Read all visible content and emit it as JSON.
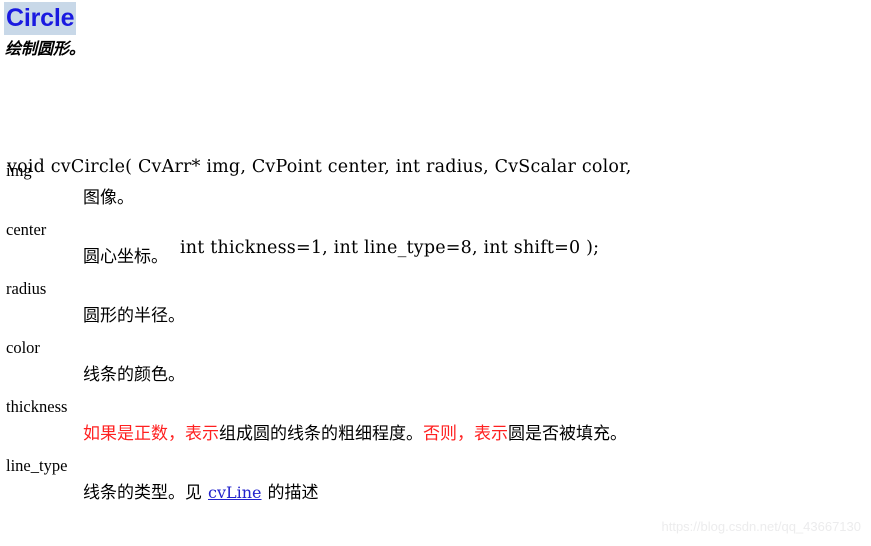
{
  "page": {
    "title": "Circle",
    "subtitle": "绘制圆形。",
    "title_color": "#1a1ae0",
    "title_highlight_color": "#c8d8e8",
    "background_color": "#ffffff"
  },
  "signature": {
    "line1": "void cvCircle( CvArr* img, CvPoint center, int radius, CvScalar color,",
    "line2": "int thickness=1, int line_type=8, int shift=0 );"
  },
  "parameters": [
    {
      "term": "img",
      "desc": "图像。"
    },
    {
      "term": "center",
      "desc": "圆心坐标。"
    },
    {
      "term": "radius",
      "desc": "圆形的半径。"
    },
    {
      "term": "color",
      "desc": "线条的颜色。"
    },
    {
      "term": "thickness",
      "desc_segments": [
        {
          "text": "如果是正数，表示",
          "color": "#ff2020"
        },
        {
          "text": "组成圆的线条的粗细程度。",
          "color": "#000000"
        },
        {
          "text": "否则，表示",
          "color": "#ff2020"
        },
        {
          "text": "圆是否被填充。",
          "color": "#000000"
        }
      ]
    },
    {
      "term": "line_type",
      "desc_prefix": "线条的类型。见",
      "desc_link": "cvLine",
      "desc_suffix": "的描述"
    }
  ],
  "watermark": {
    "text": "https://blog.csdn.net/qq_43667130"
  }
}
